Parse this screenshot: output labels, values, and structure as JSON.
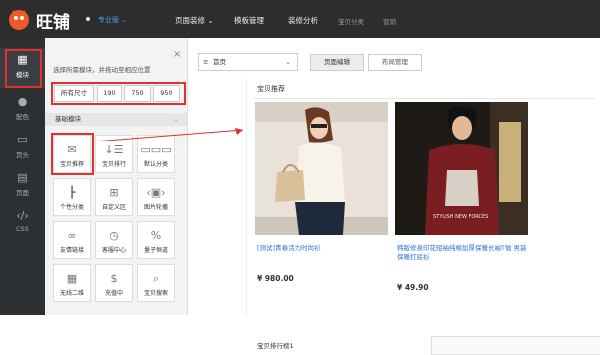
{
  "topbar": {
    "brand": "旺铺",
    "edition": "专业版",
    "nav": [
      "页面装修",
      "模板管理",
      "装修分析",
      "宝贝分类",
      "营销"
    ]
  },
  "rail": {
    "items": [
      "模块",
      "配色",
      "页头",
      "页面",
      "CSS"
    ]
  },
  "panel": {
    "hint": "选择所需模块，并拖动至相应位置",
    "sizes": [
      "所有尺寸",
      "190",
      "750",
      "950"
    ],
    "section": "基础模块",
    "modules": [
      "宝贝推荐",
      "宝贝排行",
      "默认分类",
      "个性分类",
      "自定义区",
      "图片轮播",
      "友情链接",
      "客服中心",
      "量子恒道",
      "无线二维",
      "充值中",
      "宝贝搜索"
    ]
  },
  "main": {
    "page_select": "首页",
    "tabs": [
      "页面编辑",
      "布局管理"
    ],
    "section_title": "宝贝推荐",
    "products": [
      {
        "title": "[测试]青春活力时尚衫",
        "price": "¥ 980.00"
      },
      {
        "title": "韩版修身印花短袖纯棉加厚保暖长袖T恤 男装保暖打底衫",
        "price": "¥ 49.90"
      }
    ],
    "bottom_title": "宝贝排行榜1"
  },
  "colors": {
    "topbar": "#2d2d2d",
    "rail": "#2d3033",
    "accent": "#e03030",
    "link": "#2a6fd6"
  }
}
